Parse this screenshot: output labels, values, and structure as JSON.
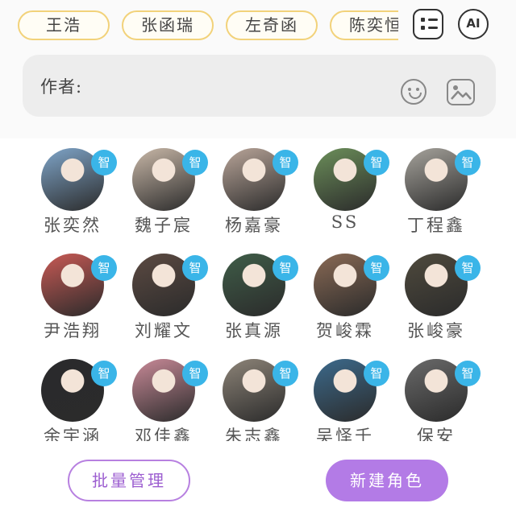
{
  "author_chips": [
    "王浩",
    "张函瑞",
    "左奇函",
    "陈奕恒"
  ],
  "toolbar": {
    "ai_label": "AI"
  },
  "composer": {
    "author_label": "作者:"
  },
  "badge_text": "智",
  "characters": [
    {
      "name": "张奕然",
      "color": "#7fa5c9"
    },
    {
      "name": "魏子宸",
      "color": "#c9b8a8"
    },
    {
      "name": "杨嘉豪",
      "color": "#b9a599"
    },
    {
      "name": "SS",
      "color": "#6c8f5a"
    },
    {
      "name": "丁程鑫",
      "color": "#a6a39c"
    },
    {
      "name": "尹浩翔",
      "color": "#c95a55"
    },
    {
      "name": "刘耀文",
      "color": "#5c4a42"
    },
    {
      "name": "张真源",
      "color": "#3f5d48"
    },
    {
      "name": "贺峻霖",
      "color": "#8a6a55"
    },
    {
      "name": "张峻豪",
      "color": "#4f4a3d"
    },
    {
      "name": "余宇涵",
      "color": "#2a2a2c"
    },
    {
      "name": "邓佳鑫",
      "color": "#c98a98"
    },
    {
      "name": "朱志鑫",
      "color": "#8d8478"
    },
    {
      "name": "吴怿千",
      "color": "#3c6a8c"
    },
    {
      "name": "保安",
      "color": "#6a6a6a"
    }
  ],
  "actions": {
    "batch_label": "批量管理",
    "new_label": "新建角色"
  }
}
